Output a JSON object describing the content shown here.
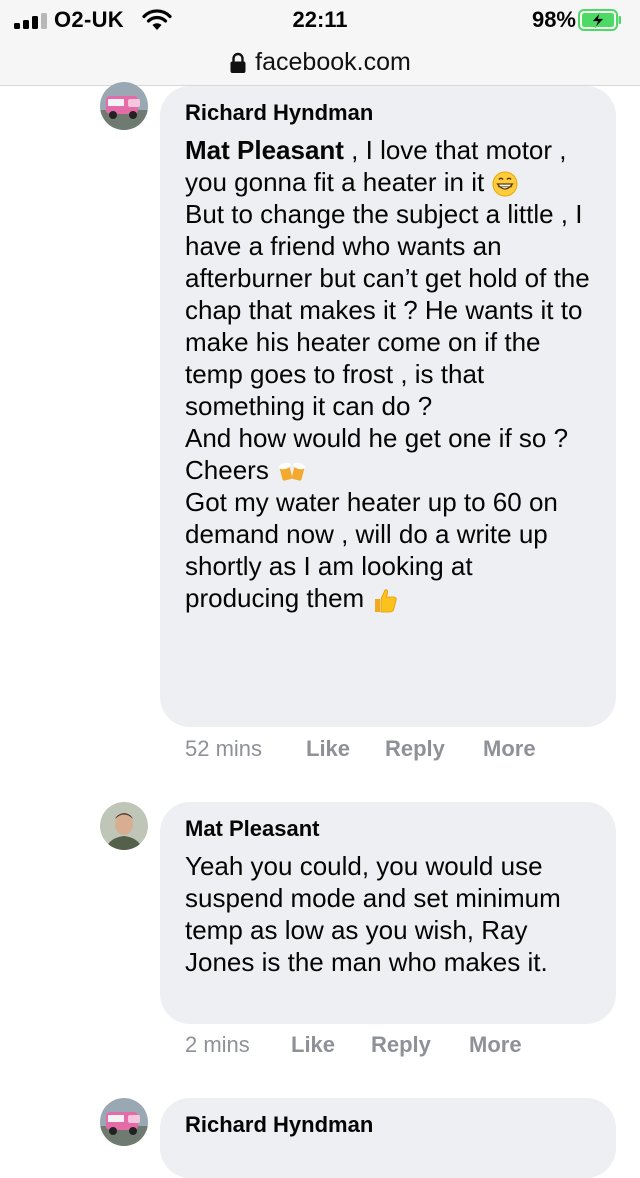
{
  "status_bar": {
    "carrier": "O2-UK",
    "time": "22:11",
    "battery_percent": "98%",
    "icons": [
      "signal-icon",
      "wifi-icon",
      "battery-charging-icon"
    ]
  },
  "url_bar": {
    "domain": "facebook.com",
    "icon": "lock-icon"
  },
  "comments": [
    {
      "author": "Richard Hyndman",
      "mention": "Mat Pleasant",
      "lines": [
        " , I love that motor , you gonna fit a heater in it ",
        "But to change the subject a little , I have a friend who wants an afterburner but can’t get hold of the chap that makes it ? He wants it to make his heater come on if the temp goes to frost , is that something it can do ?",
        "And how would he get one if so ?",
        "Cheers ",
        "Got my water heater up to 60 on demand now , will do a write up shortly as I am looking at producing them "
      ],
      "emojis": [
        "grinning-face-emoji",
        "beer-mugs-emoji",
        "thumbs-up-emoji"
      ],
      "time": "52 mins",
      "like_label": "Like",
      "reply_label": "Reply",
      "more_label": "More"
    },
    {
      "author": "Mat Pleasant",
      "text": "Yeah you could, you would use suspend mode and set minimum temp as low as you wish, Ray Jones is the man who makes it.",
      "time": "2 mins",
      "like_label": "Like",
      "reply_label": "Reply",
      "more_label": "More"
    },
    {
      "author": "Richard Hyndman"
    }
  ]
}
